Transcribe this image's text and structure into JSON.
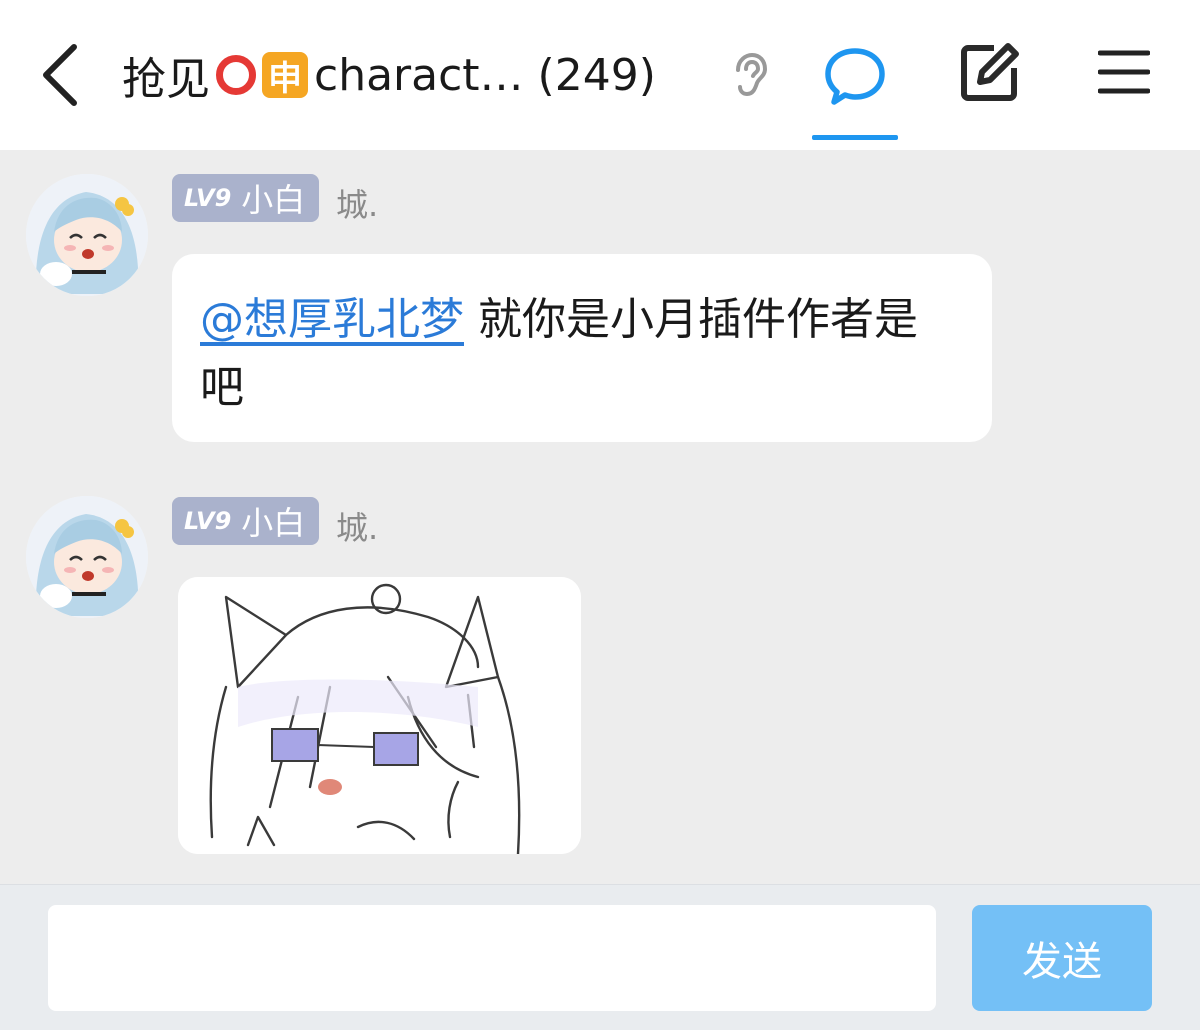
{
  "header": {
    "back_icon": "chevron-left-icon",
    "title_prefix": "抢见",
    "title_emoji_1": "red-circle-emoji",
    "title_emoji_2_char": "申",
    "title_suffix": "charact…",
    "member_count": "(249)",
    "ear_icon": "ear-icon",
    "chat_icon": "chat-bubble-icon",
    "edit_icon": "edit-icon",
    "menu_icon": "menu-icon",
    "accent_color": "#1e96f0"
  },
  "messages": [
    {
      "level": "LV9",
      "badge_name": "小白",
      "sender": "城.",
      "mention": "@想厚乳北梦",
      "text": " 就你是小月插件作者是吧"
    },
    {
      "level": "LV9",
      "badge_name": "小白",
      "sender": "城.",
      "image": "cat-ear-girl-sticker"
    }
  ],
  "composer": {
    "input_value": "",
    "input_placeholder": "",
    "send_label": "发送",
    "send_color": "#74c0f6"
  }
}
